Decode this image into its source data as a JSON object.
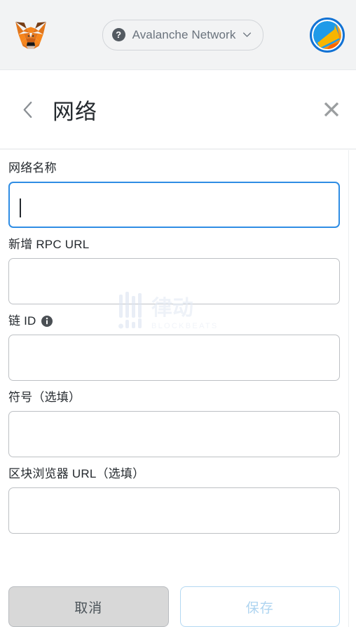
{
  "appbar": {
    "logo_name": "metamask-fox-logo",
    "network_selector": {
      "icon": "question-circle-icon",
      "label": "Avalanche Network",
      "chevron": "chevron-down-icon"
    },
    "avatar_name": "account-avatar"
  },
  "header": {
    "back_icon": "chevron-left-icon",
    "title": "网络",
    "close_icon": "close-icon"
  },
  "form": {
    "fields": [
      {
        "label": "网络名称",
        "value": "",
        "placeholder": "",
        "focused": true,
        "info": false
      },
      {
        "label": "新增 RPC URL",
        "value": "",
        "placeholder": "",
        "focused": false,
        "info": false
      },
      {
        "label": "链 ID",
        "value": "",
        "placeholder": "",
        "focused": false,
        "info": true,
        "info_icon": "info-circle-icon"
      },
      {
        "label": "符号（选填）",
        "value": "",
        "placeholder": "",
        "focused": false,
        "info": false
      },
      {
        "label": "区块浏览器 URL（选填）",
        "value": "",
        "placeholder": "",
        "focused": false,
        "info": false
      }
    ]
  },
  "footer": {
    "cancel_label": "取消",
    "save_label": "保存"
  },
  "watermark": {
    "cn_text": "律动",
    "en_text": "BLOCKBEATS"
  },
  "colors": {
    "accent_blue": "#2f8de4",
    "appbar_bg": "#f2f3f4",
    "input_border": "#bdc0c4",
    "cancel_bg": "#d8d8d8",
    "save_disabled": "#aed4f0",
    "fox_orange": "#e2761b",
    "avatar_ring": "#1272d4"
  }
}
